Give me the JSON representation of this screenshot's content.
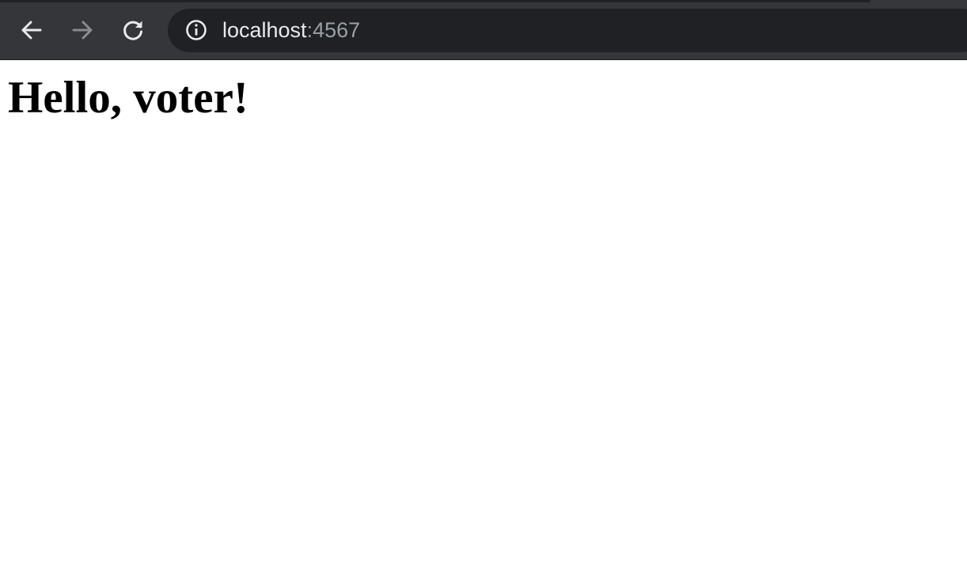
{
  "browser": {
    "address_bar": {
      "host": "localhost",
      "port": ":4567"
    },
    "icons": {
      "back": "arrow-left-icon",
      "forward": "arrow-right-icon",
      "reload": "reload-icon",
      "site_info": "info-icon"
    },
    "colors": {
      "toolbar": "#35363a",
      "omnibox": "#202124",
      "host_text": "#e8eaed",
      "port_text": "#9aa0a6",
      "forward_disabled": "#8a8b8e"
    }
  },
  "page": {
    "heading": "Hello, voter!"
  }
}
